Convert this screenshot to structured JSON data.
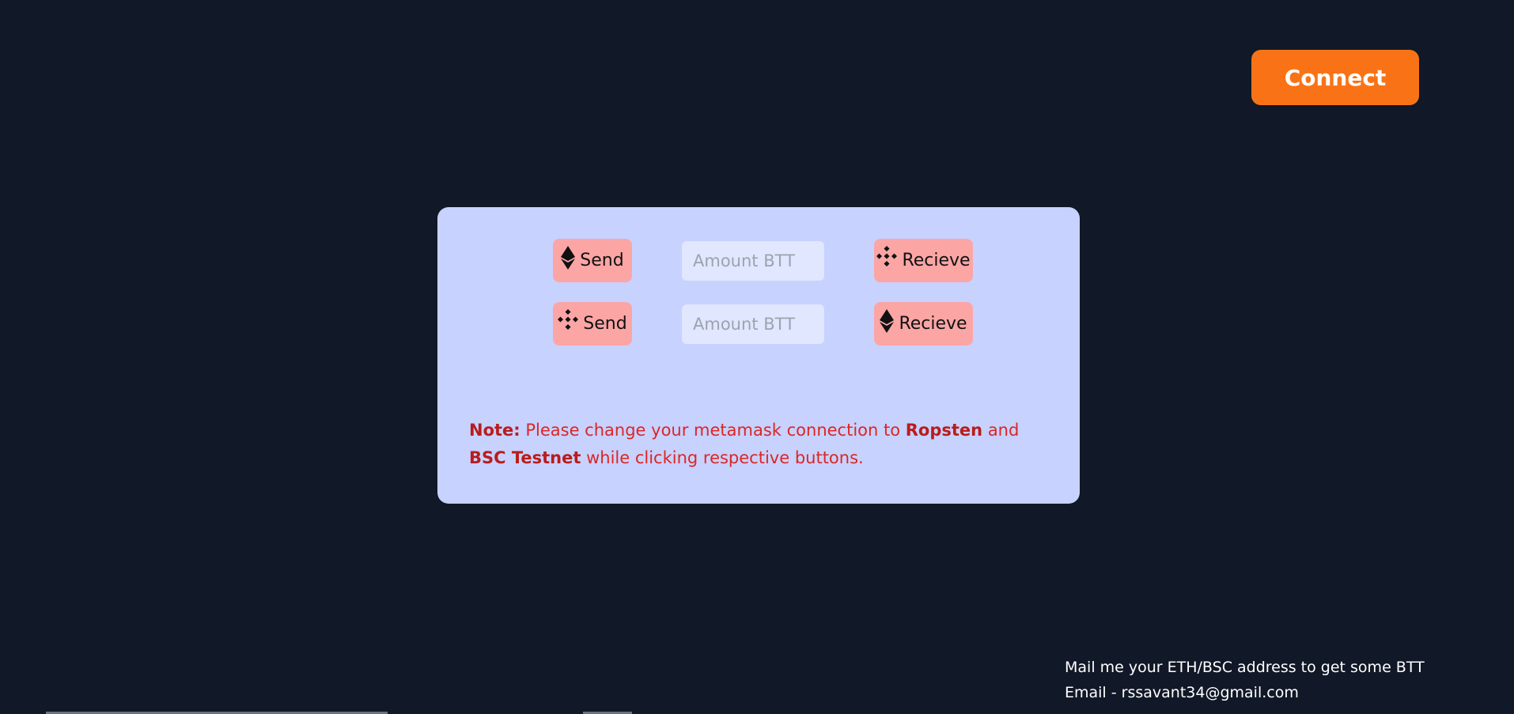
{
  "header": {
    "connect_label": "Connect"
  },
  "swap_card": {
    "rows": [
      {
        "send_icon": "ethereum-icon",
        "send_label": "Send",
        "amount_placeholder": "Amount BTT",
        "amount_value": "",
        "receive_icon": "binance-icon",
        "receive_label": "Recieve"
      },
      {
        "send_icon": "binance-icon",
        "send_label": "Send",
        "amount_placeholder": "Amount BTT",
        "amount_value": "",
        "receive_icon": "ethereum-icon",
        "receive_label": "Recieve"
      }
    ],
    "note": {
      "label": "Note:",
      "text_1": " Please change your metamask connection to ",
      "network_1": "Ropsten",
      "text_2": " and ",
      "network_2": "BSC Testnet",
      "text_3": " while clicking respective buttons."
    }
  },
  "footer": {
    "line_1": "Mail me your ETH/BSC address to get some BTT",
    "line_2": "Email - rssavant34@gmail.com"
  },
  "colors": {
    "background": "#111827",
    "connect_button": "#f97316",
    "card": "#c7d2fe",
    "action_button": "#fca5a5",
    "note_text": "#dc2626"
  }
}
